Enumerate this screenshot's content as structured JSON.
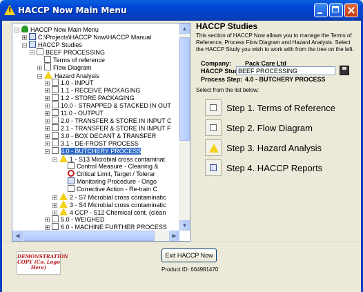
{
  "window": {
    "title": "HACCP Now Main Menu"
  },
  "tree": {
    "nodes": [
      "HACCP Now Main Menu",
      "C:\\Projects\\HACCP Now\\HACCP Manual",
      "HACCP Studies",
      "BEEF PROCESSING",
      "Terms of reference",
      "Flow Diagram",
      "Hazard Analysis",
      "1.0 - INPUT",
      "1.1 - RECEIVE PACKAGING",
      "1.2 - STORE PACKAGING",
      "10.0 - STRAPPED & STACKED IN OUT",
      "11.0 - OUTPUT",
      "2.0 - TRANSFER & STORE IN INPUT C",
      "2.1 - TRANSFER & STORE IN INPUT F",
      "3.0 - BOX DECANT & TRANSFER",
      "3.1 - DE-FROST PROCESS",
      "4.0 - BUTCHERY PROCESS",
      "1 - S13 Microbial cross contaminat",
      "Control Measure - Cleaning &",
      "Critical Limit, Target / Tolerar",
      "Monitoring Procedure - Ongo",
      "Corrective Action - Re-train C",
      "2 - S7 Microbial cross contaminatic",
      "3 - S4 Microbial cross contaminatic",
      "4 CCP - S12 Chemical cont. (clean",
      "5.0 - WEIGHED",
      "6.0 - MACHINE FURTHER PROCESS"
    ]
  },
  "panel": {
    "title": "HACCP Studies",
    "description": "This section of HACCP Now allows you to manage the Terms of Reference, Process Flow Diagram and Hazard Analysis. Select the HACCP Study you wish to work with from the tree on the left.",
    "company_label": "Company:",
    "company_value": "Pack Care Ltd",
    "study_label": "HACCP Study:",
    "study_value": "BEEF PROCESSING",
    "process_label": "Process Step:",
    "process_value": "4.0 - BUTCHERY PROCESS",
    "select_text": "Select from the list below:",
    "steps": [
      "Step 1. Terms of Reference",
      "Step 2. Flow Diagram",
      "Step 3. Hazard Analysis",
      "Step 4. HACCP Reports"
    ]
  },
  "footer": {
    "logo_text": "DEMONSTRATION COPY (Co. Logo Here)",
    "exit_label": "Exit HACCP Now",
    "product_id": "Product ID: 664981470"
  },
  "colors": {
    "selection": "#316ac5",
    "titlebar": "#0046d6",
    "window_bg": "#ece9d8"
  }
}
